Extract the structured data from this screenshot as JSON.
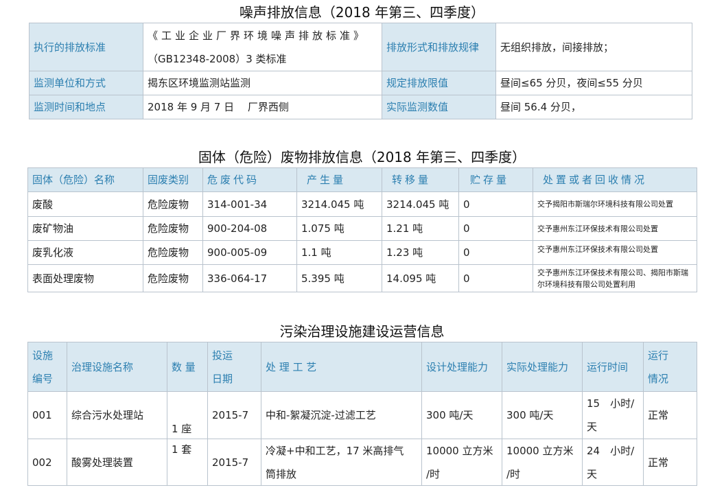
{
  "noise": {
    "title": "噪声排放信息（2018 年第三、四季度）",
    "rows": [
      {
        "label1": "执行的排放标准",
        "value1_line1": "《工业企业厂界环境噪声排放标准》",
        "value1_line2": "（GB12348-2008）3 类标准",
        "label2": "排放形式和排放规律",
        "value2": "无组织排放，间接排放；"
      },
      {
        "label1": "监测单位和方式",
        "value1": "揭东区环境监测站监测",
        "label2": "规定排放限值",
        "value2": "昼间≤65 分贝，夜间≤55 分贝"
      },
      {
        "label1": "监测时间和地点",
        "value1": "2018 年 9 月 7 日　 厂界西侧",
        "label2": "实际监测数值",
        "value2": "昼间 56.4 分贝，"
      }
    ]
  },
  "waste": {
    "title": "固体（危险）废物排放信息（2018 年第三、四季度）",
    "headers": [
      "固体（危险）名称",
      "固废类别",
      "危废代码",
      "产生量",
      "转移量",
      "贮存量",
      "处置或者回收情况"
    ],
    "rows": [
      {
        "name": "废酸",
        "category": "危险废物",
        "code": "314-001-34",
        "produced": "3214.045 吨",
        "transferred": "3214.045 吨",
        "stored": "0",
        "disposal": "交予揭阳市斯瑞尔环境科技有限公司处置"
      },
      {
        "name": "废矿物油",
        "category": "危险废物",
        "code": "900-204-08",
        "produced": "1.075 吨",
        "transferred": "1.21 吨",
        "stored": "0",
        "disposal": "交予惠州东江环保技术有限公司处置"
      },
      {
        "name": "废乳化液",
        "category": "危险废物",
        "code": "900-005-09",
        "produced": "1.1 吨",
        "transferred": "1.23 吨",
        "stored": "0",
        "disposal": "交予惠州东江环保技术有限公司处置"
      },
      {
        "name": "表面处理废物",
        "category": "危险废物",
        "code": "336-064-17",
        "produced": "5.395 吨",
        "transferred": "14.095 吨",
        "stored": "0",
        "disposal": "交予惠州东江环保技术有限公司、揭阳市斯瑞尔环境科技有限公司处置利用"
      }
    ]
  },
  "facility": {
    "title": "污染治理设施建设运营信息",
    "headers": {
      "id_line1": "设施",
      "id_line2": "编号",
      "name": "治理设施名称",
      "qty": "数 量",
      "date_line1": "投运",
      "date_line2": "日期",
      "process": "处 理 工 艺",
      "design": "设计处理能力",
      "actual": "实际处理能力",
      "hours": "运行时间",
      "status_line1": "运行",
      "status_line2": "情况"
    },
    "rows": [
      {
        "id": "001",
        "name": "综合污水处理站",
        "qty": "1 座",
        "date": "2015-7",
        "process": "中和-絮凝沉淀-过滤工艺",
        "design": "300 吨/天",
        "actual": "300 吨/天",
        "hours_line1": "15　小时/",
        "hours_line2": "天",
        "status": "正常"
      },
      {
        "id": "002",
        "name": "酸雾处理装置",
        "qty": "1 套",
        "date": "2015-7",
        "process_line1": "冷凝+中和工艺，17 米高排气",
        "process_line2": "筒排放",
        "design_line1": "10000 立方米",
        "design_line2": "/时",
        "actual_line1": "10000 立方米",
        "actual_line2": "/时",
        "hours_line1": "24　小时/",
        "hours_line2": "天",
        "status": "正常"
      }
    ]
  }
}
